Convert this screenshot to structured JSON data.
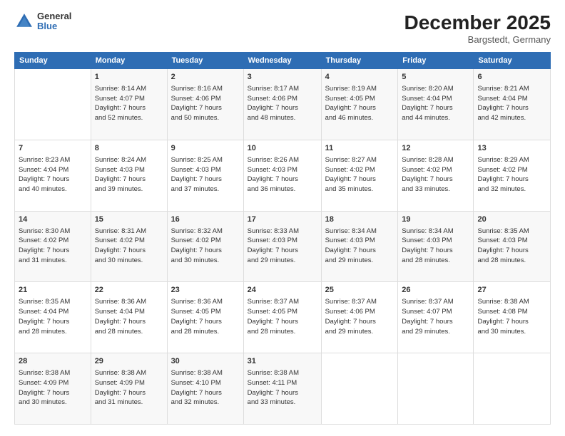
{
  "header": {
    "logo": {
      "general": "General",
      "blue": "Blue"
    },
    "title": "December 2025",
    "location": "Bargstedt, Germany"
  },
  "calendar": {
    "days_of_week": [
      "Sunday",
      "Monday",
      "Tuesday",
      "Wednesday",
      "Thursday",
      "Friday",
      "Saturday"
    ],
    "weeks": [
      [
        {
          "day": "",
          "content": ""
        },
        {
          "day": "1",
          "content": "Sunrise: 8:14 AM\nSunset: 4:07 PM\nDaylight: 7 hours\nand 52 minutes."
        },
        {
          "day": "2",
          "content": "Sunrise: 8:16 AM\nSunset: 4:06 PM\nDaylight: 7 hours\nand 50 minutes."
        },
        {
          "day": "3",
          "content": "Sunrise: 8:17 AM\nSunset: 4:06 PM\nDaylight: 7 hours\nand 48 minutes."
        },
        {
          "day": "4",
          "content": "Sunrise: 8:19 AM\nSunset: 4:05 PM\nDaylight: 7 hours\nand 46 minutes."
        },
        {
          "day": "5",
          "content": "Sunrise: 8:20 AM\nSunset: 4:04 PM\nDaylight: 7 hours\nand 44 minutes."
        },
        {
          "day": "6",
          "content": "Sunrise: 8:21 AM\nSunset: 4:04 PM\nDaylight: 7 hours\nand 42 minutes."
        }
      ],
      [
        {
          "day": "7",
          "content": "Sunrise: 8:23 AM\nSunset: 4:04 PM\nDaylight: 7 hours\nand 40 minutes."
        },
        {
          "day": "8",
          "content": "Sunrise: 8:24 AM\nSunset: 4:03 PM\nDaylight: 7 hours\nand 39 minutes."
        },
        {
          "day": "9",
          "content": "Sunrise: 8:25 AM\nSunset: 4:03 PM\nDaylight: 7 hours\nand 37 minutes."
        },
        {
          "day": "10",
          "content": "Sunrise: 8:26 AM\nSunset: 4:03 PM\nDaylight: 7 hours\nand 36 minutes."
        },
        {
          "day": "11",
          "content": "Sunrise: 8:27 AM\nSunset: 4:02 PM\nDaylight: 7 hours\nand 35 minutes."
        },
        {
          "day": "12",
          "content": "Sunrise: 8:28 AM\nSunset: 4:02 PM\nDaylight: 7 hours\nand 33 minutes."
        },
        {
          "day": "13",
          "content": "Sunrise: 8:29 AM\nSunset: 4:02 PM\nDaylight: 7 hours\nand 32 minutes."
        }
      ],
      [
        {
          "day": "14",
          "content": "Sunrise: 8:30 AM\nSunset: 4:02 PM\nDaylight: 7 hours\nand 31 minutes."
        },
        {
          "day": "15",
          "content": "Sunrise: 8:31 AM\nSunset: 4:02 PM\nDaylight: 7 hours\nand 30 minutes."
        },
        {
          "day": "16",
          "content": "Sunrise: 8:32 AM\nSunset: 4:02 PM\nDaylight: 7 hours\nand 30 minutes."
        },
        {
          "day": "17",
          "content": "Sunrise: 8:33 AM\nSunset: 4:03 PM\nDaylight: 7 hours\nand 29 minutes."
        },
        {
          "day": "18",
          "content": "Sunrise: 8:34 AM\nSunset: 4:03 PM\nDaylight: 7 hours\nand 29 minutes."
        },
        {
          "day": "19",
          "content": "Sunrise: 8:34 AM\nSunset: 4:03 PM\nDaylight: 7 hours\nand 28 minutes."
        },
        {
          "day": "20",
          "content": "Sunrise: 8:35 AM\nSunset: 4:03 PM\nDaylight: 7 hours\nand 28 minutes."
        }
      ],
      [
        {
          "day": "21",
          "content": "Sunrise: 8:35 AM\nSunset: 4:04 PM\nDaylight: 7 hours\nand 28 minutes."
        },
        {
          "day": "22",
          "content": "Sunrise: 8:36 AM\nSunset: 4:04 PM\nDaylight: 7 hours\nand 28 minutes."
        },
        {
          "day": "23",
          "content": "Sunrise: 8:36 AM\nSunset: 4:05 PM\nDaylight: 7 hours\nand 28 minutes."
        },
        {
          "day": "24",
          "content": "Sunrise: 8:37 AM\nSunset: 4:05 PM\nDaylight: 7 hours\nand 28 minutes."
        },
        {
          "day": "25",
          "content": "Sunrise: 8:37 AM\nSunset: 4:06 PM\nDaylight: 7 hours\nand 29 minutes."
        },
        {
          "day": "26",
          "content": "Sunrise: 8:37 AM\nSunset: 4:07 PM\nDaylight: 7 hours\nand 29 minutes."
        },
        {
          "day": "27",
          "content": "Sunrise: 8:38 AM\nSunset: 4:08 PM\nDaylight: 7 hours\nand 30 minutes."
        }
      ],
      [
        {
          "day": "28",
          "content": "Sunrise: 8:38 AM\nSunset: 4:09 PM\nDaylight: 7 hours\nand 30 minutes."
        },
        {
          "day": "29",
          "content": "Sunrise: 8:38 AM\nSunset: 4:09 PM\nDaylight: 7 hours\nand 31 minutes."
        },
        {
          "day": "30",
          "content": "Sunrise: 8:38 AM\nSunset: 4:10 PM\nDaylight: 7 hours\nand 32 minutes."
        },
        {
          "day": "31",
          "content": "Sunrise: 8:38 AM\nSunset: 4:11 PM\nDaylight: 7 hours\nand 33 minutes."
        },
        {
          "day": "",
          "content": ""
        },
        {
          "day": "",
          "content": ""
        },
        {
          "day": "",
          "content": ""
        }
      ]
    ]
  }
}
